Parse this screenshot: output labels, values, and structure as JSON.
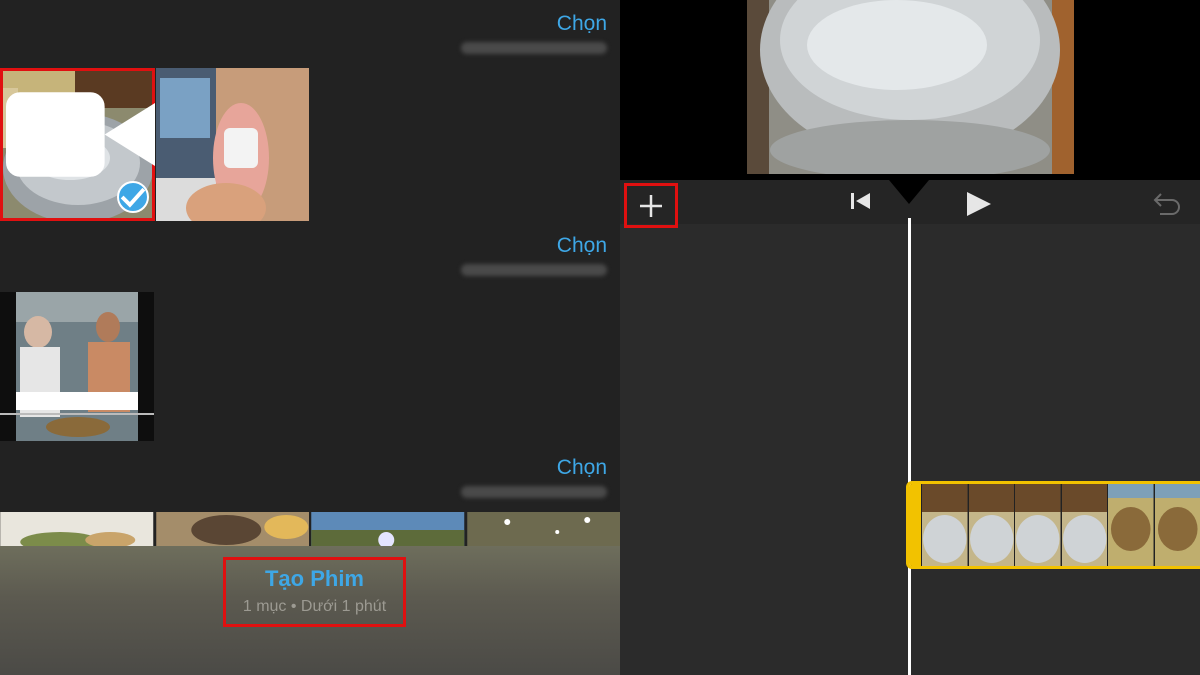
{
  "library": {
    "sections": [
      {
        "select_label": "Chọn"
      },
      {
        "select_label": "Chọn"
      },
      {
        "select_label": "Chọn"
      }
    ]
  },
  "create_movie": {
    "title": "Tạo Phim",
    "subtitle": "1 mục • Dưới 1 phút"
  },
  "colors": {
    "accent": "#3ea7e6",
    "highlight": "#e01010",
    "clip_border": "#f2c200"
  }
}
